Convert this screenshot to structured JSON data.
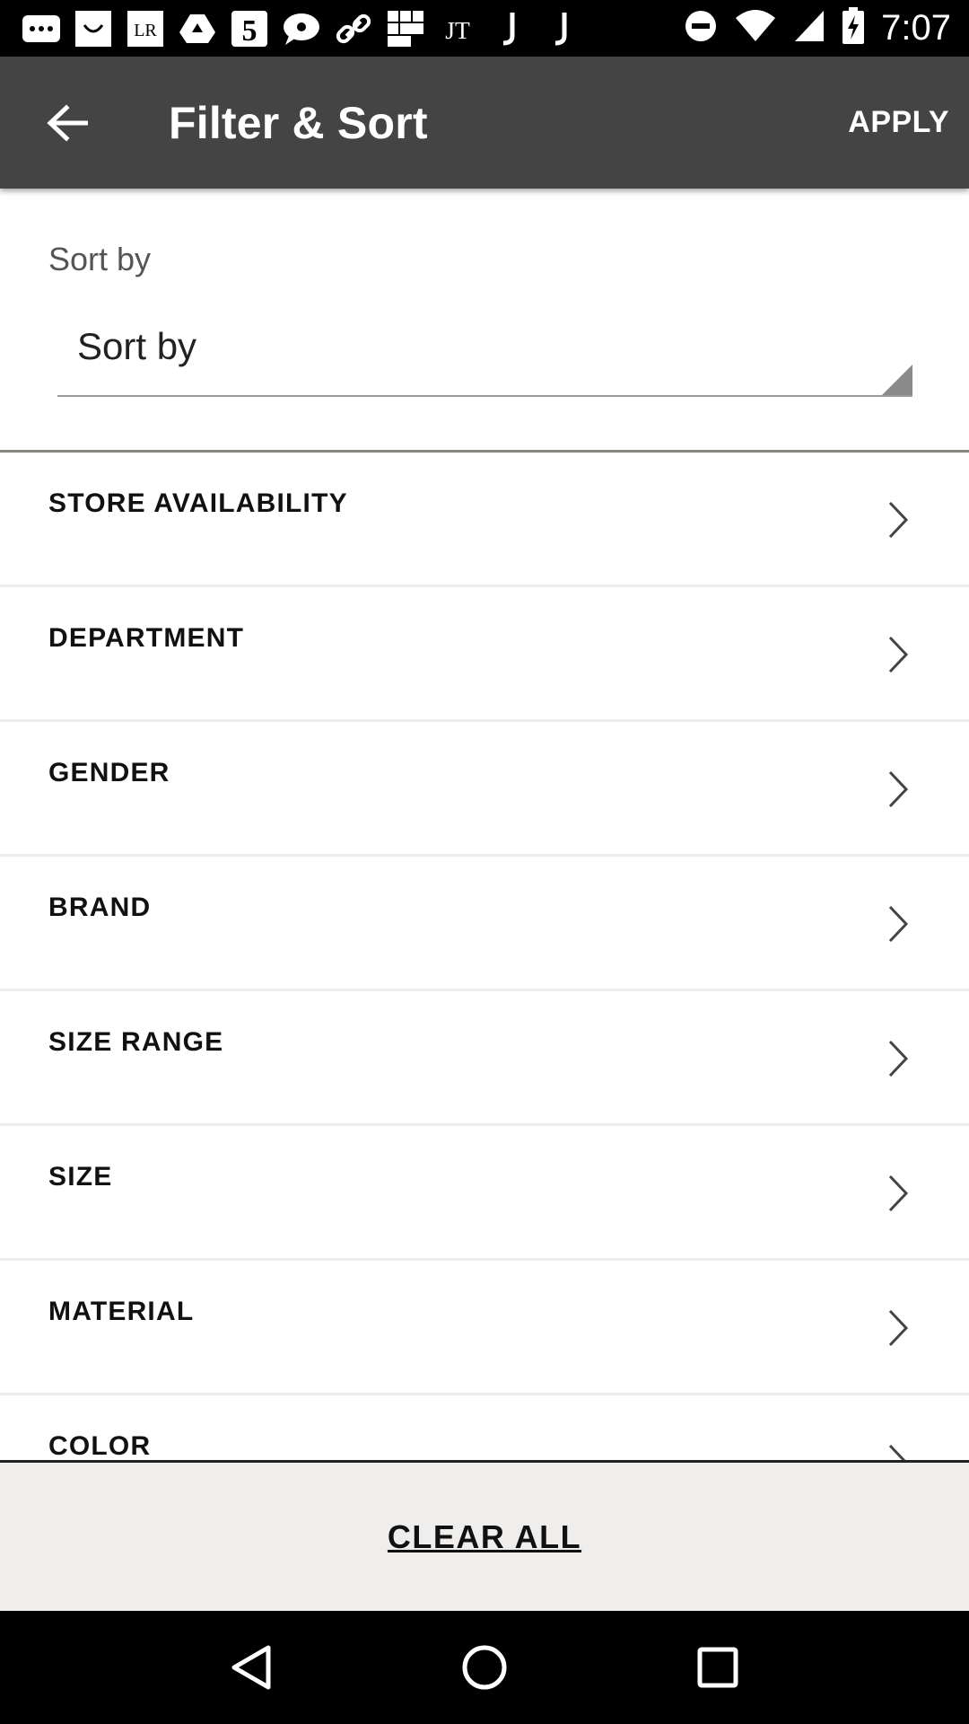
{
  "status_bar": {
    "time": "7:07",
    "notification_icons": [
      "messages-icon",
      "kohls-icon",
      "lr-icon",
      "drive-icon",
      "five-icon",
      "chat-icon",
      "link-icon",
      "grid-icon",
      "jt-icon",
      "j-icon",
      "j-icon"
    ],
    "system_icons": [
      "do-not-disturb-icon",
      "wifi-icon",
      "signal-icon",
      "battery-charging-icon"
    ]
  },
  "app_bar": {
    "title": "Filter & Sort",
    "apply_label": "APPLY"
  },
  "sort": {
    "label": "Sort by",
    "selected": "Sort by"
  },
  "filters": [
    {
      "label": "STORE AVAILABILITY"
    },
    {
      "label": "DEPARTMENT"
    },
    {
      "label": "GENDER"
    },
    {
      "label": "BRAND"
    },
    {
      "label": "SIZE RANGE"
    },
    {
      "label": "SIZE"
    },
    {
      "label": "MATERIAL"
    },
    {
      "label": "COLOR"
    }
  ],
  "bottom": {
    "clear_all_label": "CLEAR ALL"
  },
  "colors": {
    "app_bar": "#444444",
    "bottom_bar": "#efeeec",
    "divider": "#ececec"
  }
}
